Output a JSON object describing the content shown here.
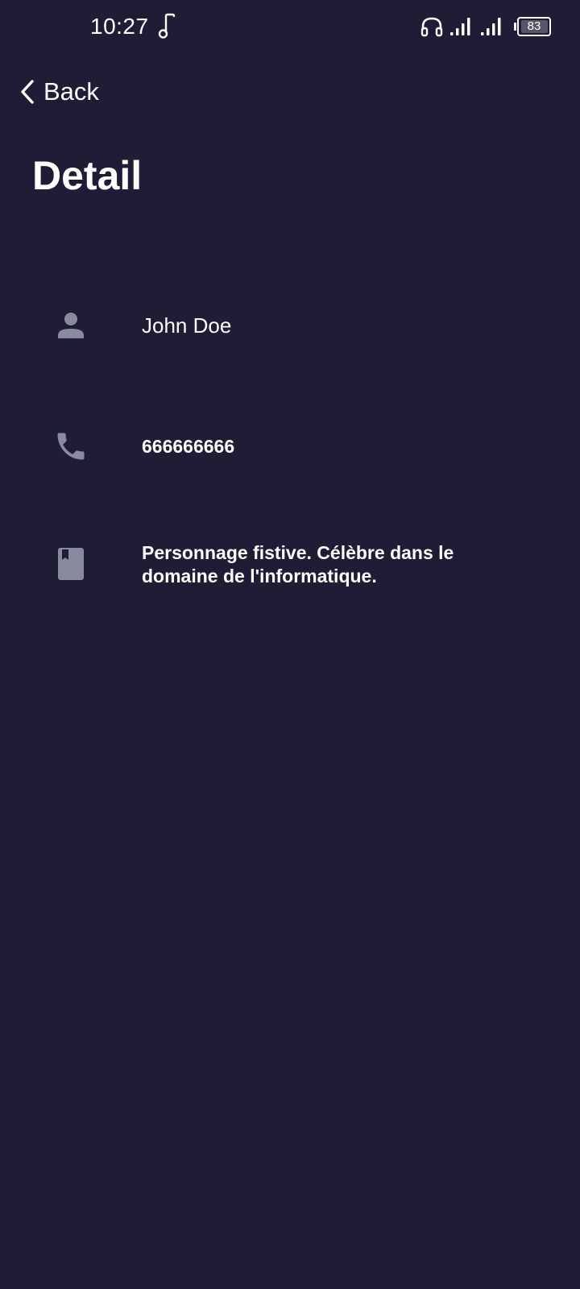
{
  "status_bar": {
    "time": "10:27",
    "battery_level": "83",
    "icons": [
      "music-note-icon",
      "headphones-icon",
      "signal-icon",
      "signal-icon",
      "battery-icon"
    ]
  },
  "nav": {
    "back_label": "Back",
    "back_icon": "chevron-left-icon"
  },
  "page": {
    "title": "Detail"
  },
  "details": {
    "name": {
      "icon": "person-icon",
      "value": "John Doe"
    },
    "phone": {
      "icon": "phone-icon",
      "value": "666666666"
    },
    "description": {
      "icon": "book-icon",
      "value": "Personnage fistive. Célèbre dans le domaine de l'informatique."
    }
  },
  "colors": {
    "background": "#1e1d35",
    "text": "#ffffff",
    "icon": "#8a8a9e"
  }
}
